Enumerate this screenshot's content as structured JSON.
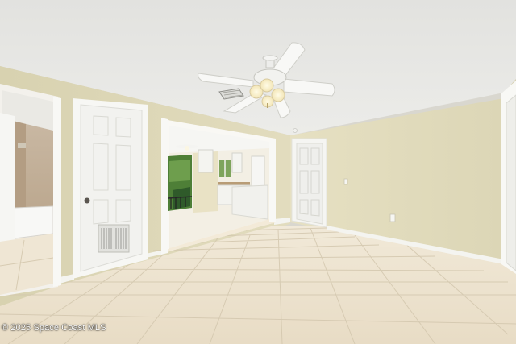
{
  "photo": {
    "watermark": "© 2025 Space Coast MLS"
  },
  "colors": {
    "ceiling": "#e6e6e3",
    "wall": "#ddd7b8",
    "floor": "#ece2cf",
    "door": "#f4f4f1",
    "trim": "#f7f7f4"
  }
}
